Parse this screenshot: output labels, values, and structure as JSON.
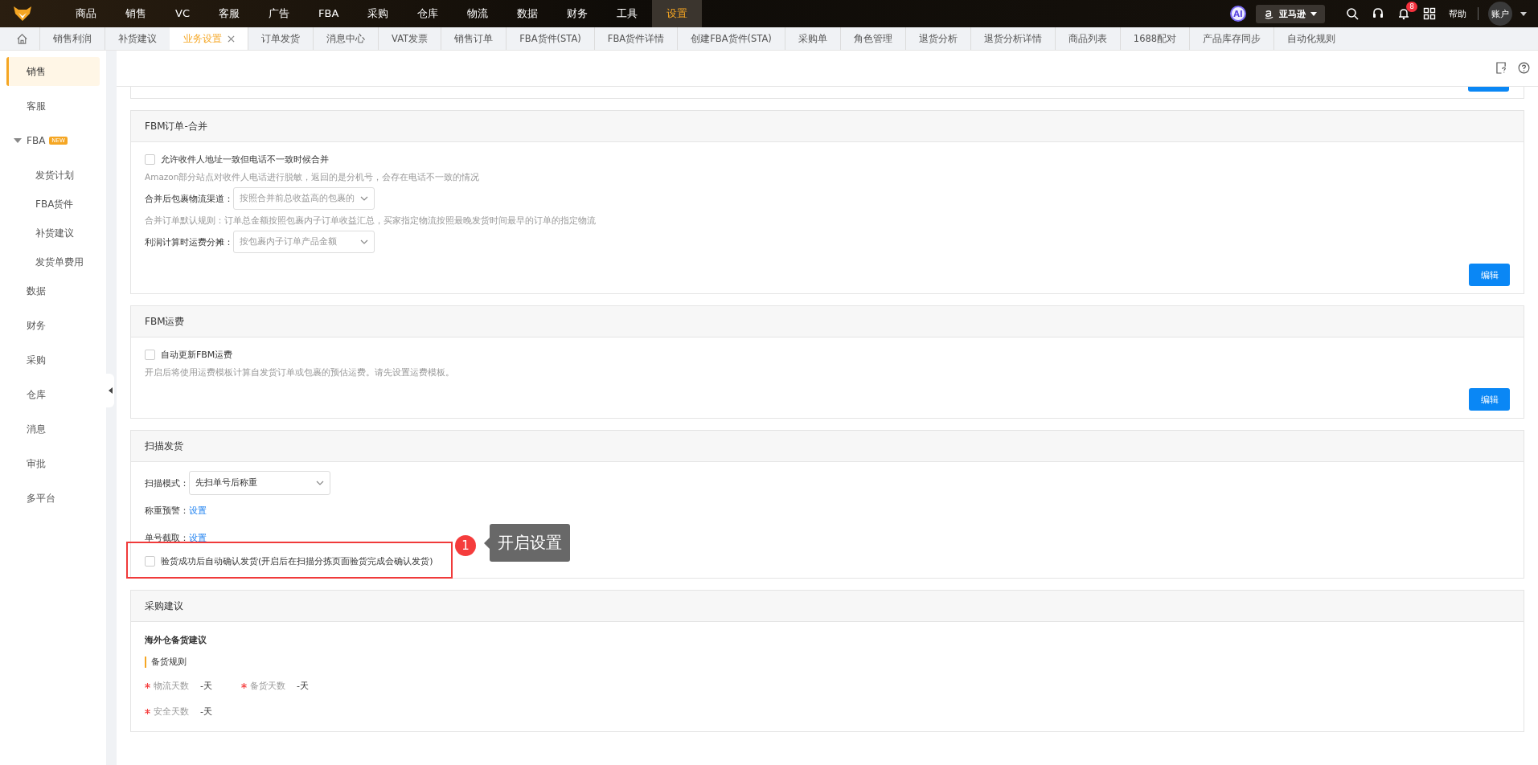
{
  "top_nav": {
    "items": [
      {
        "label": "商品",
        "selected": false
      },
      {
        "label": "销售",
        "selected": false
      },
      {
        "label": "VC",
        "selected": false
      },
      {
        "label": "客服",
        "selected": false
      },
      {
        "label": "广告",
        "selected": false
      },
      {
        "label": "FBA",
        "selected": false
      },
      {
        "label": "采购",
        "selected": false
      },
      {
        "label": "仓库",
        "selected": false
      },
      {
        "label": "物流",
        "selected": false
      },
      {
        "label": "数据",
        "selected": false
      },
      {
        "label": "财务",
        "selected": false
      },
      {
        "label": "工具",
        "selected": false
      },
      {
        "label": "设置",
        "selected": true
      }
    ],
    "ai_label": "AI",
    "store": "亚马逊",
    "notification_count": "8",
    "help": "帮助",
    "account": "账户"
  },
  "tabs": [
    {
      "label": "销售利润",
      "selected": false
    },
    {
      "label": "补货建议",
      "selected": false
    },
    {
      "label": "业务设置",
      "selected": true
    },
    {
      "label": "订单发货",
      "selected": false
    },
    {
      "label": "消息中心",
      "selected": false
    },
    {
      "label": "VAT发票",
      "selected": false
    },
    {
      "label": "销售订单",
      "selected": false
    },
    {
      "label": "FBA货件(STA)",
      "selected": false
    },
    {
      "label": "FBA货件详情",
      "selected": false
    },
    {
      "label": "创建FBA货件(STA)",
      "selected": false
    },
    {
      "label": "采购单",
      "selected": false
    },
    {
      "label": "角色管理",
      "selected": false
    },
    {
      "label": "退货分析",
      "selected": false
    },
    {
      "label": "退货分析详情",
      "selected": false
    },
    {
      "label": "商品列表",
      "selected": false
    },
    {
      "label": "1688配对",
      "selected": false
    },
    {
      "label": "产品库存同步",
      "selected": false
    },
    {
      "label": "自动化规则",
      "selected": false
    }
  ],
  "sidebar": {
    "items": [
      {
        "label": "销售",
        "selected": true
      },
      {
        "label": "客服",
        "selected": false
      },
      {
        "label": "FBA",
        "selected": false,
        "badge": "NEW",
        "expanded": true,
        "children": [
          {
            "label": "发货计划",
            "selected": false
          },
          {
            "label": "FBA货件",
            "selected": false
          },
          {
            "label": "补货建议",
            "selected": false
          },
          {
            "label": "发货单费用",
            "selected": false
          }
        ]
      },
      {
        "label": "数据",
        "selected": false
      },
      {
        "label": "财务",
        "selected": false
      },
      {
        "label": "采购",
        "selected": false
      },
      {
        "label": "仓库",
        "selected": false
      },
      {
        "label": "消息",
        "selected": false
      },
      {
        "label": "审批",
        "selected": false
      },
      {
        "label": "多平台",
        "selected": false
      }
    ]
  },
  "sections": [
    {
      "kind": "cut_off"
    },
    {
      "kind": "card",
      "title": "FBM订单-合并",
      "button": "编辑",
      "rows": [
        {
          "kind": "checkbox",
          "label": "允许收件人地址一致但电话不一致时候合并",
          "checked": false
        },
        {
          "kind": "hint",
          "text": "Amazon部分站点对收件人电话进行脱敏，返回的是分机号，会存在电话不一致的情况"
        },
        {
          "kind": "select",
          "label": "合并后包裹物流渠道：",
          "placeholder": "按照合并前总收益高的包裹的"
        },
        {
          "kind": "hint",
          "text": "合并订单默认规则：订单总金额按照包裹内子订单收益汇总，买家指定物流按照最晚发货时间最早的订单的指定物流"
        },
        {
          "kind": "select",
          "label": "利润计算时运费分摊：",
          "placeholder": "按包裹内子订单产品金额"
        }
      ]
    },
    {
      "kind": "card",
      "title": "FBM运费",
      "button": "编辑",
      "rows": [
        {
          "kind": "checkbox",
          "label": "自动更新FBM运费",
          "checked": false
        },
        {
          "kind": "hint",
          "text": "开启后将使用运费模板计算自发货订单或包裹的预估运费。请先设置运费模板。"
        }
      ]
    },
    {
      "kind": "card",
      "title": "扫描发货",
      "rows": [
        {
          "kind": "select",
          "label": "扫描模式：",
          "value": "先扫单号后称重",
          "strong": true
        },
        {
          "kind": "link",
          "label": "称重预警：",
          "link": "设置"
        },
        {
          "kind": "link",
          "label": "单号截取：",
          "link": "设置"
        },
        {
          "kind": "checkbox",
          "label": "验货成功后自动确认发货(开启后在扫描分拣页面验货完成会确认发货)",
          "checked": false,
          "callout": {
            "number": "1",
            "text": "开启设置"
          }
        }
      ]
    },
    {
      "kind": "card",
      "title": "采购建议",
      "rows": [
        {
          "kind": "subheading",
          "text": "海外仓备货建议"
        },
        {
          "kind": "rule_title",
          "text": "备货规则"
        },
        {
          "kind": "fields",
          "fields": [
            {
              "label": "物流天数",
              "value": "-天",
              "required": true
            },
            {
              "label": "备货天数",
              "value": "-天",
              "required": true
            }
          ]
        },
        {
          "kind": "fields",
          "fields": [
            {
              "label": "安全天数",
              "value": "-天",
              "required": true
            }
          ]
        }
      ]
    }
  ]
}
